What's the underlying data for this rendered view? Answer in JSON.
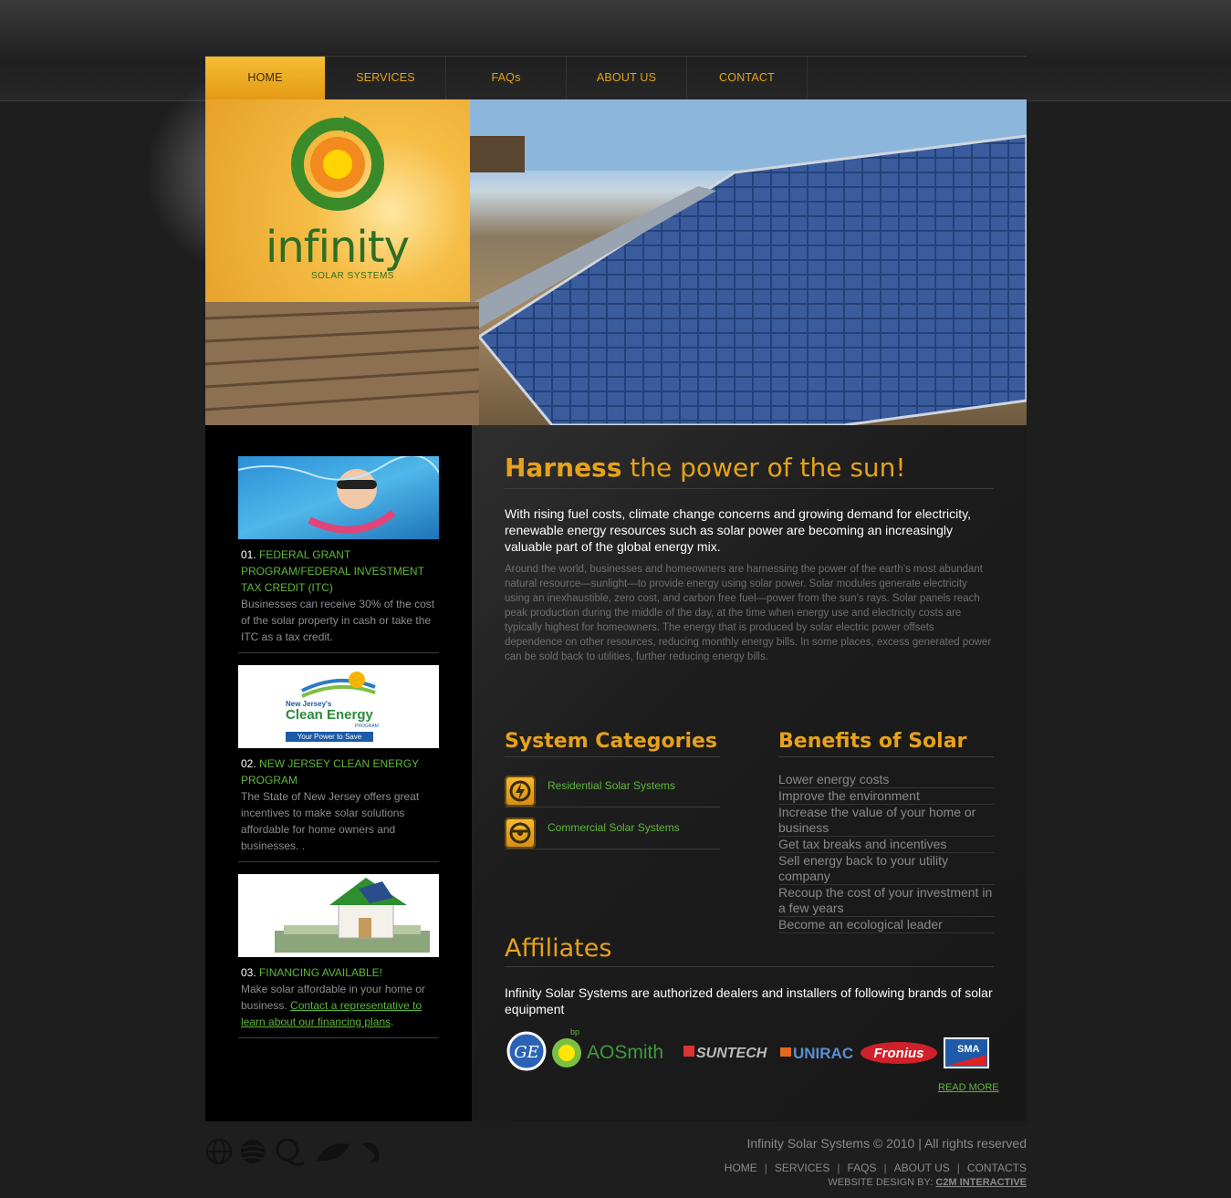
{
  "nav": {
    "items": [
      {
        "label": "HOME",
        "active": true
      },
      {
        "label": "SERVICES"
      },
      {
        "label": "FAQs"
      },
      {
        "label": "ABOUT US"
      },
      {
        "label": "CONTACT"
      }
    ]
  },
  "hero": {
    "logo_word": "infinity",
    "logo_sub": "SOLAR SYSTEMS"
  },
  "sidebar": {
    "promos": [
      {
        "num": "01.",
        "title": "FEDERAL GRANT PROGRAM/FEDERAL INVESTMENT TAX CREDIT (ITC)",
        "text": "Businesses can receive 30% of the cost of the solar property in cash or take the ITC as a tax credit."
      },
      {
        "num": "02.",
        "title": "NEW JERSEY CLEAN ENERGY PROGRAM",
        "text": "The State of New Jersey offers great incentives to make solar solutions affordable for home owners and businesses. .",
        "image_text": {
          "line1": "New Jersey's",
          "line2": "Clean Energy",
          "line3": "PROGRAM",
          "tagline": "Your Power to Save"
        }
      },
      {
        "num": "03.",
        "title": "FINANCING AVAILABLE!",
        "text_before": "Make solar affordable in your home or business. ",
        "link": "Contact a representative to learn about our financing plans",
        "text_after": "."
      }
    ]
  },
  "main": {
    "heading_bold": "Harness",
    "heading_light": " the power of the sun!",
    "lead": "With rising fuel costs, climate change concerns and growing demand for electricity, renewable energy resources such as solar power are becoming an increasingly valuable part of the global energy mix.",
    "body": "Around the world, businesses and homeowners are harnessing the power of the earth’s most abundant natural resource—sunlight—to provide energy using solar power. Solar modules generate electricity using an inexhaustible, zero cost, and carbon free fuel—power from the sun’s rays. Solar panels reach peak production during the middle of the day, at the time when energy use and electricity costs are typically highest for homeowners. The energy that is produced by solar electric power offsets dependence on other resources, reducing monthly energy bills. In some places, excess generated power can be sold back to utilities, further reducing energy bills.",
    "categories_title": "System Categories",
    "categories": [
      {
        "label": "Residential Solar Systems",
        "icon": "residential-power-icon"
      },
      {
        "label": "Commercial Solar Systems",
        "icon": "commercial-steering-icon"
      }
    ],
    "benefits_title": "Benefits of Solar",
    "benefits": [
      "Lower energy costs",
      "Improve the environment",
      "Increase the value of your home or business",
      "Get tax breaks and incentives",
      "Sell energy back to your utility company",
      "Recoup the cost of your investment in a few years",
      "Become an ecological leader"
    ],
    "affiliates_title": "Affiliates",
    "affiliates_text": "Infinity Solar Systems are authorized dealers and installers of following brands of solar equipment",
    "brand_logos": {
      "ge": "GE",
      "bp": "bp",
      "aosmith": "AOSmith",
      "suntech": "SUNTECH",
      "unirac": "UNIRAC",
      "fronius": "Fronius",
      "sma": "SMA"
    },
    "read_more": "READ MORE"
  },
  "footer": {
    "copyright": "Infinity Solar Systems © 2010 | All rights reserved",
    "nav": [
      "HOME",
      "SERVICES",
      "FAQS",
      "ABOUT US",
      "CONTACTS"
    ],
    "credit_label": "WEBSITE DESIGN BY: ",
    "credit_link": "C2M INTERACTIVE",
    "icons": [
      "globe-icon",
      "sphere-icon",
      "headset-icon",
      "leaf-icon",
      "swirl-icon"
    ]
  },
  "colors": {
    "accent": "#e6a21a",
    "link_green": "#5eb83a",
    "background": "#1e1e1e"
  }
}
